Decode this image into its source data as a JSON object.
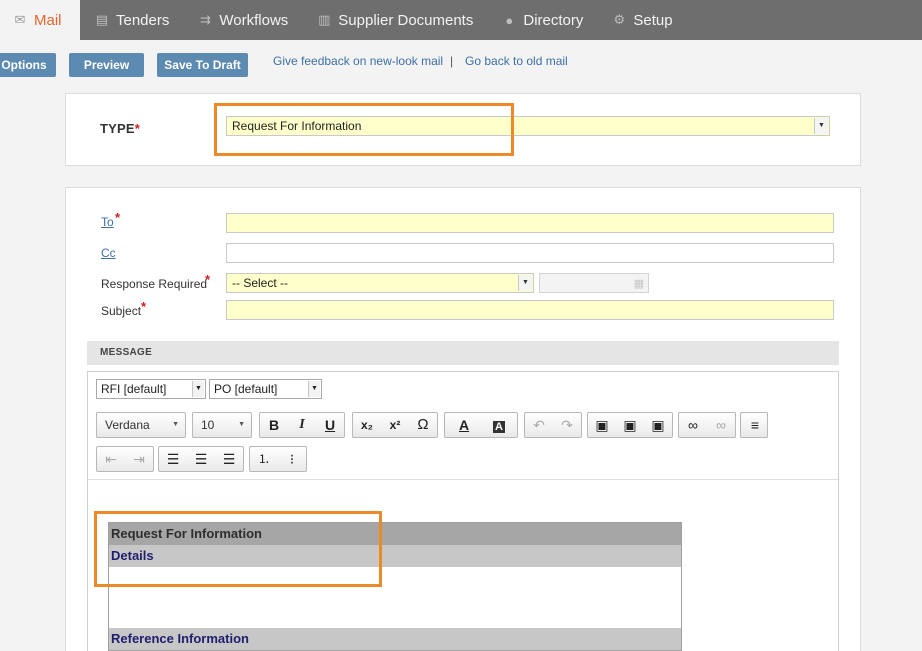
{
  "nav": {
    "tabs": [
      {
        "label": "Mail",
        "icon": "mail-icon",
        "glyph": "✉"
      },
      {
        "label": "Tenders",
        "icon": "document-icon",
        "glyph": "▤"
      },
      {
        "label": "Workflows",
        "icon": "workflow-icon",
        "glyph": "⇉"
      },
      {
        "label": "Supplier Documents",
        "icon": "binders-icon",
        "glyph": "▥"
      },
      {
        "label": "Directory",
        "icon": "users-icon",
        "glyph": "●"
      },
      {
        "label": "Setup",
        "icon": "gear-icon",
        "glyph": "⚙"
      }
    ]
  },
  "toolbar": {
    "options_label": "Options",
    "preview_label": "Preview",
    "save_draft_label": "Save To Draft",
    "feedback_link": "Give feedback on new-look mail",
    "separator": "|",
    "old_mail_link": "Go back to old mail"
  },
  "type_panel": {
    "label": "TYPE",
    "required": "*",
    "value": "Request For Information"
  },
  "form": {
    "to_label": "To",
    "cc_label": "Cc",
    "response_label": "Response Required",
    "response_value": "-- Select --",
    "subject_label": "Subject",
    "required": "*"
  },
  "message": {
    "header": "MESSAGE",
    "template1": "RFI [default]",
    "template2": "PO [default]",
    "font": "Verdana",
    "size": "10",
    "bold": "B",
    "italic": "I",
    "underline": "U",
    "subscript": "x₂",
    "superscript": "x²",
    "omega": "Ω",
    "text_color": "A",
    "bg_color": "A",
    "undo": "↶",
    "redo": "↷",
    "table": {
      "title": "Request For Information",
      "details": "Details",
      "reference": "Reference Information"
    }
  },
  "colors": {
    "accent": "#e0662e",
    "nav_bg": "#6e6e6e",
    "button": "#5d8ab0",
    "required_field": "#ffffcc",
    "highlight": "#ec8a2a"
  }
}
